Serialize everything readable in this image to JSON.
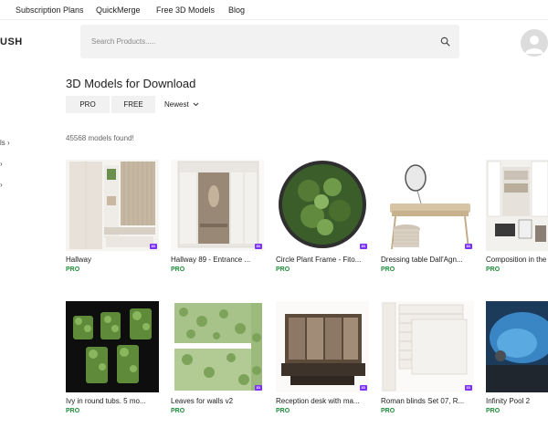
{
  "topnav": {
    "links": [
      "Subscription Plans",
      "QuickMerge",
      "Free 3D Models",
      "Blog"
    ]
  },
  "header": {
    "logo": "USH",
    "search_placeholder": "Search Products.....",
    "search_icon": "search-icon",
    "avatar_icon": "user-avatar-icon"
  },
  "sidebar": {
    "partial_item": "ls",
    "chevron": "›"
  },
  "main": {
    "title": "3D Models for Download",
    "filters": {
      "pro": "PRO",
      "free": "FREE"
    },
    "sort": {
      "label": "Newest",
      "icon": "chevron-down-icon"
    },
    "results_count": "45568 models found!"
  },
  "products": [
    {
      "title": "Hallway",
      "tier": "PRO"
    },
    {
      "title": "Hallway 89 - Entrance ...",
      "tier": "PRO"
    },
    {
      "title": "Circle Plant Frame - Fito...",
      "tier": "PRO"
    },
    {
      "title": "Dressing table Dall'Agn...",
      "tier": "PRO"
    },
    {
      "title": "Composition in the",
      "tier": "PRO"
    },
    {
      "title": "Ivy in round tubs. 5 mo...",
      "tier": "PRO"
    },
    {
      "title": "Leaves for walls v2",
      "tier": "PRO"
    },
    {
      "title": "Reception desk with ma...",
      "tier": "PRO"
    },
    {
      "title": "Roman blinds Set 07, R...",
      "tier": "PRO"
    },
    {
      "title": "Infinity Pool 2",
      "tier": "PRO"
    }
  ],
  "colors": {
    "tier_pro": "#1f8c3a",
    "badge": "#7b2ff7",
    "search_bg": "#f2f2f2"
  }
}
